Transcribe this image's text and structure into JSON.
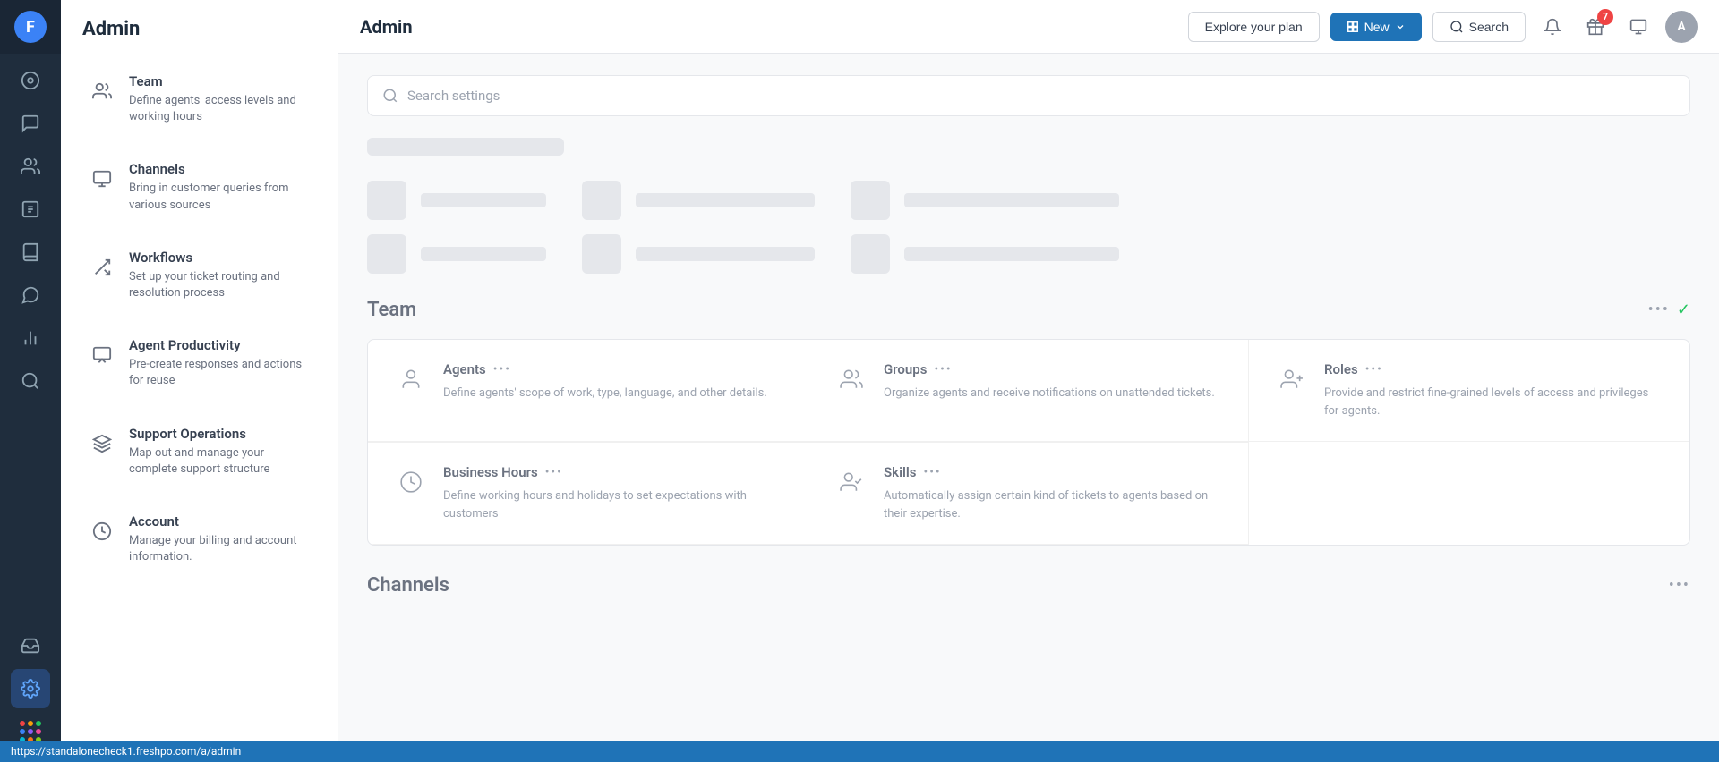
{
  "app": {
    "logo_letter": "F",
    "title": "Admin"
  },
  "topbar": {
    "title": "Admin",
    "explore_label": "Explore your plan",
    "new_label": "New",
    "search_label": "Search",
    "notification_badge": "7",
    "avatar_label": "A"
  },
  "search": {
    "placeholder": "Search settings"
  },
  "sidebar": {
    "items": [
      {
        "id": "team",
        "label": "Team",
        "description": "Define agents' access levels and working hours"
      },
      {
        "id": "channels",
        "label": "Channels",
        "description": "Bring in customer queries from various sources"
      },
      {
        "id": "workflows",
        "label": "Workflows",
        "description": "Set up your ticket routing and resolution process"
      },
      {
        "id": "agent-productivity",
        "label": "Agent Productivity",
        "description": "Pre-create responses and actions for reuse"
      },
      {
        "id": "support-operations",
        "label": "Support Operations",
        "description": "Map out and manage your complete support structure"
      },
      {
        "id": "account",
        "label": "Account",
        "description": "Manage your billing and account information."
      }
    ]
  },
  "nav": {
    "items": [
      "🏠",
      "💬",
      "👥",
      "🔗",
      "📖",
      "💬",
      "📊",
      "🔍",
      "⚙️"
    ],
    "bottom_items": [
      "💬",
      "⚙️",
      "⋯"
    ]
  },
  "team_section": {
    "title": "Team",
    "cards": [
      {
        "id": "agents",
        "title": "Agents",
        "description": "Define agents' scope of work, type, language, and other details."
      },
      {
        "id": "groups",
        "title": "Groups",
        "description": "Organize agents and receive notifications on unattended tickets."
      },
      {
        "id": "roles",
        "title": "Roles",
        "description": "Provide and restrict fine-grained levels of access and privileges for agents."
      },
      {
        "id": "business-hours",
        "title": "Business Hours",
        "description": "Define working hours and holidays to set expectations with customers"
      },
      {
        "id": "skills",
        "title": "Skills",
        "description": "Automatically assign certain kind of tickets to agents based on their expertise."
      }
    ]
  },
  "channels_section": {
    "title": "Channels"
  },
  "status_bar": {
    "url": "https://standalonecheck1.freshpo.com/a/admin"
  }
}
